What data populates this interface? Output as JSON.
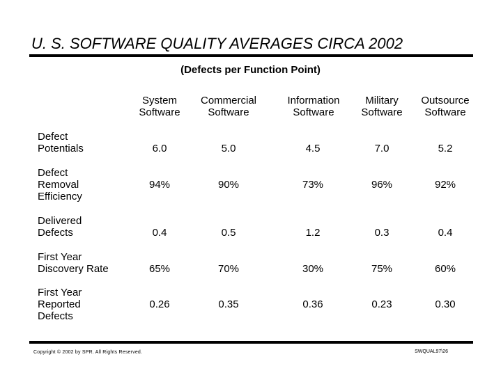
{
  "title": "U. S. SOFTWARE QUALITY AVERAGES CIRCA 2002",
  "subtitle": "(Defects per Function Point)",
  "columns": [
    {
      "line1": "System",
      "line2": "Software"
    },
    {
      "line1": "Commercial",
      "line2": "Software"
    },
    {
      "line1": "Information",
      "line2": "Software"
    },
    {
      "line1": "Military",
      "line2": "Software"
    },
    {
      "line1": "Outsource",
      "line2": "Software"
    }
  ],
  "rows": [
    {
      "label": [
        "Defect",
        "Potentials"
      ],
      "values": [
        "6.0",
        "5.0",
        "4.5",
        "7.0",
        "5.2"
      ]
    },
    {
      "label": [
        "Defect",
        "Removal",
        "Efficiency"
      ],
      "values": [
        "94%",
        "90%",
        "73%",
        "96%",
        "92%"
      ]
    },
    {
      "label": [
        "Delivered",
        "Defects"
      ],
      "values": [
        "0.4",
        "0.5",
        "1.2",
        "0.3",
        "0.4"
      ]
    },
    {
      "label": [
        "First Year",
        "Discovery Rate"
      ],
      "values": [
        "65%",
        "70%",
        "30%",
        "75%",
        "60%"
      ]
    },
    {
      "label": [
        "First Year",
        "Reported",
        "Defects"
      ],
      "values": [
        "0.26",
        "0.35",
        "0.36",
        "0.23",
        "0.30"
      ]
    }
  ],
  "footer": {
    "copyright": "Copyright © 2002 by SPR.  All Rights Reserved.",
    "code": "SWQUAL97\\26"
  }
}
